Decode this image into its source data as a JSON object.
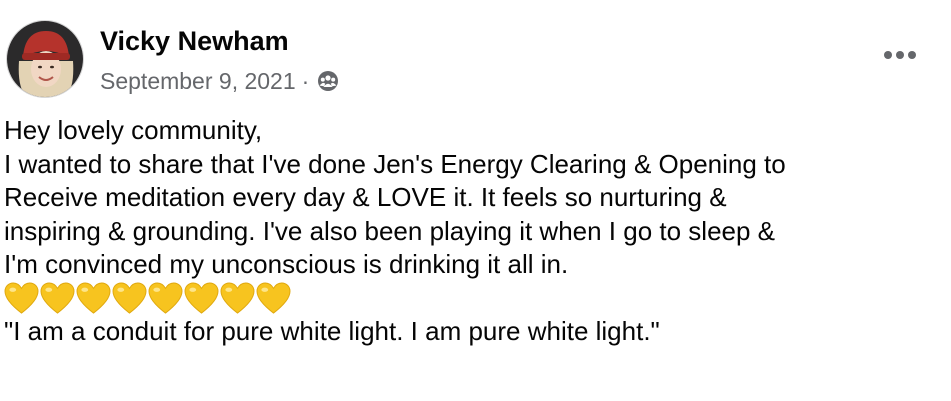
{
  "post": {
    "author": {
      "name": "Vicky Newham",
      "avatar_icon": "profile-photo"
    },
    "meta": {
      "date": "September 9, 2021",
      "separator": "·",
      "audience_icon": "group-icon"
    },
    "more_icon": "more-options-icon",
    "body": {
      "lines": [
        "Hey lovely community,",
        "I wanted to share that I've done Jen's Energy Clearing & Opening to",
        "Receive meditation every day & LOVE it. It feels so nurturing &",
        "inspiring & grounding. I've also been playing it when I go to sleep &",
        "I'm convinced my unconscious is drinking it all in."
      ],
      "hearts": [
        "💛",
        "💛",
        "💛",
        "💛",
        "💛",
        "💛",
        "💛",
        "💛"
      ],
      "heart_color": "#f7c41f",
      "quote": "\"I am a conduit for pure white light. I am pure white light.\""
    }
  },
  "colors": {
    "text": "#050505",
    "secondary_text": "#65676b",
    "background": "#ffffff"
  }
}
